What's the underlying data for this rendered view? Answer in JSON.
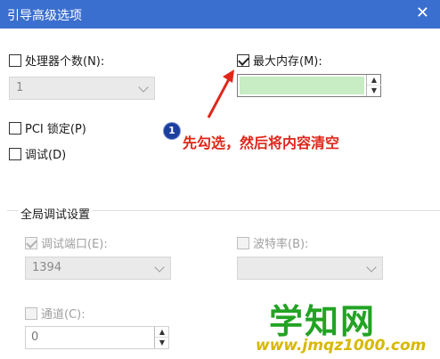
{
  "window": {
    "title": "引导高级选项",
    "close_glyph": "✕"
  },
  "processors": {
    "label": "处理器个数(N):",
    "checked": false,
    "value": "1"
  },
  "max_memory": {
    "label": "最大内存(M):",
    "checked": true,
    "value": ""
  },
  "pci_lock": {
    "label": "PCI 锁定(P)",
    "checked": false
  },
  "debug": {
    "label": "调试(D)",
    "checked": false
  },
  "annotation": {
    "badge": "1",
    "text": "先勾选，然后将内容清空",
    "color": "#e0261a"
  },
  "global_debug": {
    "title": "全局调试设置",
    "debug_port": {
      "label": "调试端口(E):",
      "checked": true,
      "value": "1394"
    },
    "baud_rate": {
      "label": "波特率(B):",
      "checked": false,
      "value": ""
    },
    "channel": {
      "label": "通道(C):",
      "checked": false,
      "value": "0"
    }
  },
  "watermark": {
    "text": "学知网",
    "url": "www.jmqz1000.com"
  },
  "colors": {
    "titlebar": "#3b6fcf",
    "memory_field": "#c8ecc4",
    "watermark": "#22a323"
  }
}
